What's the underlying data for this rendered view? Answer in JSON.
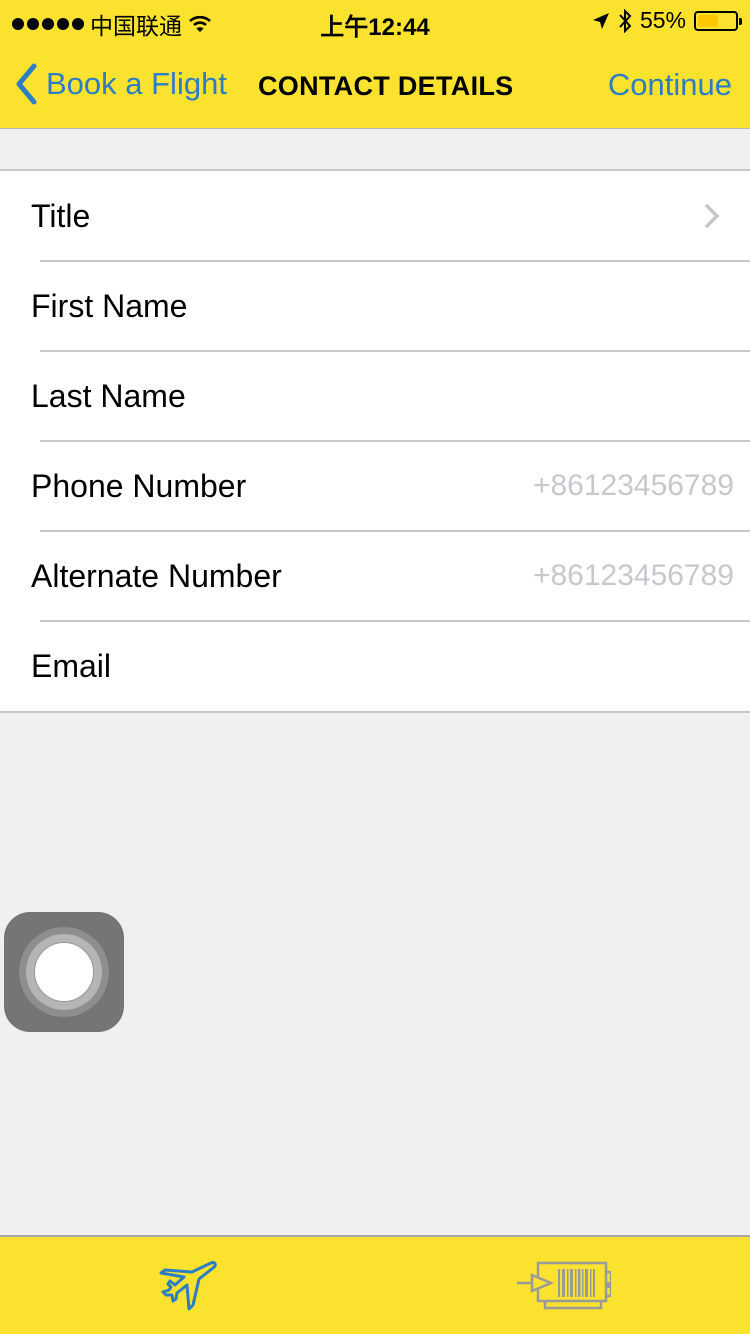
{
  "status_bar": {
    "carrier": "中国联通",
    "time": "上午12:44",
    "battery_percent_label": "55%",
    "battery_level": 0.55,
    "icons": [
      "signal-dots-icon",
      "wifi-icon",
      "location-arrow-icon",
      "bluetooth-icon",
      "battery-icon"
    ]
  },
  "nav": {
    "back_label": "Book a Flight",
    "title": "CONTACT DETAILS",
    "continue_label": "Continue",
    "accent_color": "#2d7dc5",
    "bar_color": "#fbe22f"
  },
  "form": {
    "rows": [
      {
        "label": "Title",
        "value": "",
        "placeholder": "",
        "has_chevron": true
      },
      {
        "label": "First Name",
        "value": "",
        "placeholder": ""
      },
      {
        "label": "Last Name",
        "value": "",
        "placeholder": ""
      },
      {
        "label": "Phone Number",
        "value": "",
        "placeholder": "+86123456789"
      },
      {
        "label": "Alternate Number",
        "value": "",
        "placeholder": "+86123456789"
      },
      {
        "label": "Email",
        "value": "",
        "placeholder": ""
      }
    ]
  },
  "tab_bar": {
    "tabs": [
      {
        "name": "book-flight",
        "icon": "airplane-icon",
        "active": true
      },
      {
        "name": "boarding-pass",
        "icon": "boarding-pass-icon",
        "active": false
      }
    ]
  }
}
